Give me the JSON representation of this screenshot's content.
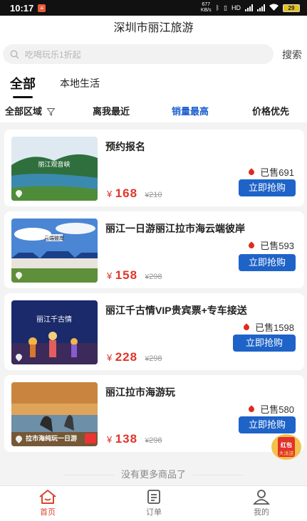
{
  "status_bar": {
    "time": "10:17",
    "speed_top": "677",
    "speed_bottom": "KB/s",
    "network": "HD",
    "battery": "29"
  },
  "header": {
    "title": "深圳市丽江旅游"
  },
  "search": {
    "placeholder": "吃喝玩乐1折起",
    "button_label": "搜索"
  },
  "tabs": [
    {
      "label": "全部"
    },
    {
      "label": "本地生活"
    }
  ],
  "filters": [
    {
      "label": "全部区域"
    },
    {
      "label": "离我最近"
    },
    {
      "label": "销量最高"
    },
    {
      "label": "价格优先"
    }
  ],
  "products": [
    {
      "title": "预约报名",
      "sold": "已售691",
      "button": "立即抢购",
      "currency": "¥",
      "price": "168",
      "old_price": "210",
      "image_text": "丽江观音峡"
    },
    {
      "title": "丽江一日游丽江拉市海云端彼岸",
      "sold": "已售593",
      "button": "立即抢购",
      "currency": "¥",
      "price": "158",
      "old_price": "298",
      "image_text": "云端彼岸"
    },
    {
      "title": "丽江千古情VIP贵宾票+专车接送",
      "sold": "已售1598",
      "button": "立即抢购",
      "currency": "¥",
      "price": "228",
      "old_price": "298",
      "image_text": "丽江千古情"
    },
    {
      "title": "丽江拉市海游玩",
      "sold": "已售580",
      "button": "立即抢购",
      "currency": "¥",
      "price": "138",
      "old_price": "298",
      "image_text": "拉市海纯玩一日游"
    }
  ],
  "list_end_text": "没有更多商品了",
  "floating_badge": {
    "line1": "红包",
    "line2": "大派送"
  },
  "bottom_nav": [
    {
      "label": "首页",
      "icon": "home-icon"
    },
    {
      "label": "订单",
      "icon": "order-icon"
    },
    {
      "label": "我的",
      "icon": "user-icon"
    }
  ],
  "colors": {
    "accent_blue": "#1e63c8",
    "price_red": "#e0342a",
    "active_nav": "#d9452c"
  }
}
